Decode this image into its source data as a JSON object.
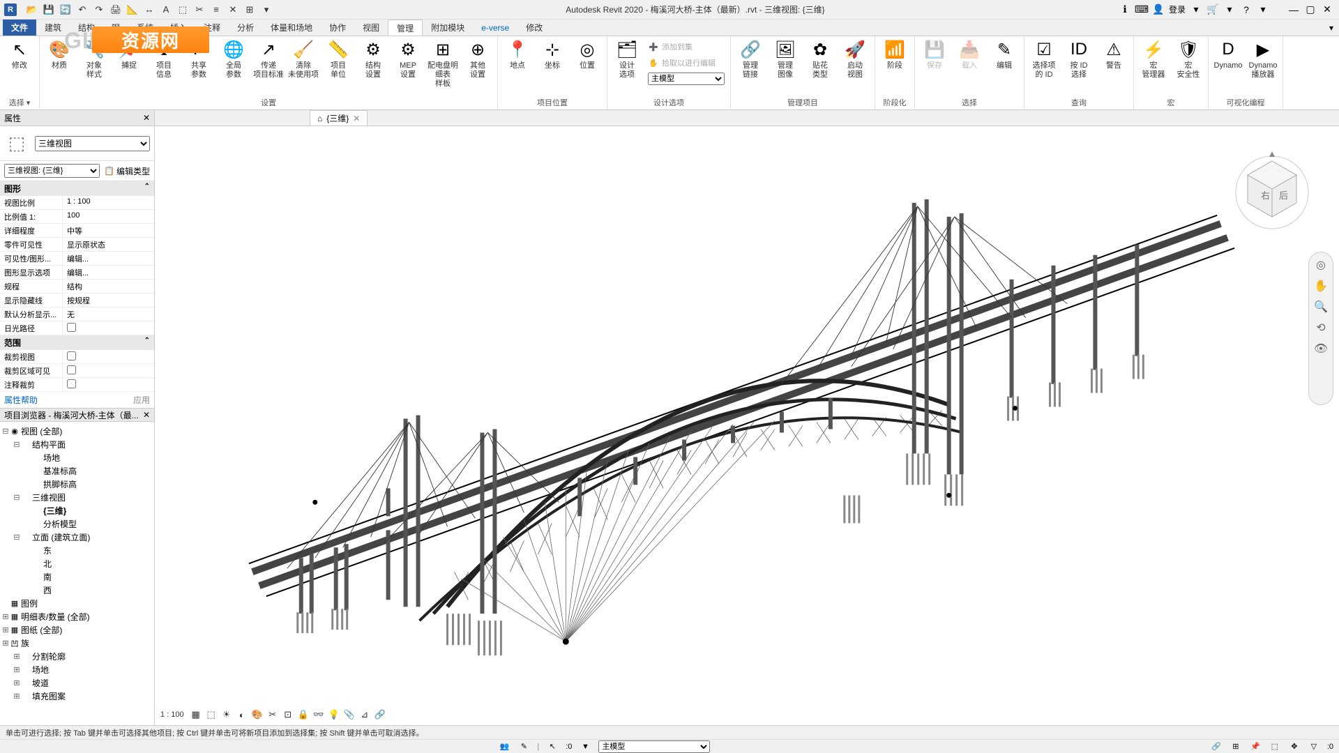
{
  "app": {
    "title": "Autodesk Revit 2020 - 梅溪河大桥-主体（最新）.rvt - 三维视图: {三维}",
    "logo": "R",
    "login": "登录",
    "qat_icons": [
      "folder",
      "save",
      "undo",
      "redo",
      "sep",
      "print",
      "measure",
      "sep",
      "line",
      "text",
      "sep",
      "3d",
      "sep",
      "section",
      "sep",
      "equals",
      "sep",
      "box",
      "minus"
    ]
  },
  "tabs": {
    "file": "文件",
    "items": [
      "建筑",
      "结构",
      "钢",
      "系统",
      "插入",
      "注释",
      "分析",
      "体量和场地",
      "协作",
      "视图",
      "管理",
      "附加模块",
      "e-verse",
      "修改"
    ],
    "active": "管理"
  },
  "ribbon": {
    "groups": [
      {
        "label": "选择 ▾",
        "buttons": [
          {
            "ico": "↖",
            "lbl": "修改"
          }
        ]
      },
      {
        "label": "设置",
        "buttons": [
          {
            "ico": "🎨",
            "lbl": "材质"
          },
          {
            "ico": "🔧",
            "lbl": "对象\n样式"
          },
          {
            "ico": "📌",
            "lbl": "捕捉"
          },
          {
            "ico": "ℹ",
            "lbl": "项目\n信息"
          },
          {
            "ico": "P",
            "lbl": "共享\n参数"
          },
          {
            "ico": "🌐",
            "lbl": "全局\n参数"
          },
          {
            "ico": "↗",
            "lbl": "传递\n项目标准"
          },
          {
            "ico": "🧹",
            "lbl": "清除\n未使用项"
          },
          {
            "ico": "📏",
            "lbl": "项目\n单位"
          },
          {
            "ico": "⚙",
            "lbl": "结构\n设置"
          },
          {
            "ico": "⚙",
            "lbl": "MEP\n设置"
          },
          {
            "ico": "⊞",
            "lbl": "配电盘明细表\n样板"
          },
          {
            "ico": "⊕",
            "lbl": "其他\n设置"
          }
        ]
      },
      {
        "label": "项目位置",
        "buttons": [
          {
            "ico": "📍",
            "lbl": "地点"
          },
          {
            "ico": "⊹",
            "lbl": "坐标"
          },
          {
            "ico": "◎",
            "lbl": "位置"
          }
        ]
      },
      {
        "label": "设计选项",
        "rows": [
          {
            "ico": "🗂",
            "lbl": "设计\n选项"
          },
          {
            "row": "添加到集",
            "ico2": "➕"
          },
          {
            "row": "拾取以进行编辑",
            "ico2": "✋"
          },
          {
            "sel": "主模型"
          }
        ]
      },
      {
        "label": "管理项目",
        "buttons": [
          {
            "ico": "🔗",
            "lbl": "管理\n链接"
          },
          {
            "ico": "🖼",
            "lbl": "管理\n图像"
          },
          {
            "ico": "✿",
            "lbl": "贴花\n类型"
          },
          {
            "ico": "🚀",
            "lbl": "启动\n视图"
          }
        ]
      },
      {
        "label": "阶段化",
        "buttons": [
          {
            "ico": "📶",
            "lbl": "阶段"
          }
        ]
      },
      {
        "label": "选择",
        "buttons": [
          {
            "ico": "💾",
            "lbl": "保存",
            "disabled": true
          },
          {
            "ico": "📥",
            "lbl": "载入",
            "disabled": true
          },
          {
            "ico": "✎",
            "lbl": "编辑"
          }
        ]
      },
      {
        "label": "查询",
        "buttons": [
          {
            "ico": "☑",
            "lbl": "选择项\n的 ID"
          },
          {
            "ico": "ID",
            "lbl": "按 ID\n选择"
          },
          {
            "ico": "⚠",
            "lbl": "警告"
          }
        ]
      },
      {
        "label": "宏",
        "buttons": [
          {
            "ico": "⚡",
            "lbl": "宏\n管理器"
          },
          {
            "ico": "🛡",
            "lbl": "宏\n安全性"
          }
        ]
      },
      {
        "label": "可视化编程",
        "buttons": [
          {
            "ico": "D",
            "lbl": "Dynamo"
          },
          {
            "ico": "▶",
            "lbl": "Dynamo\n播放器"
          }
        ]
      }
    ]
  },
  "watermark": "资源网",
  "doctab": {
    "icon": "⌂",
    "label": "{三维}"
  },
  "props": {
    "panel": "属性",
    "type": "三维视图",
    "instance": "三维视图: {三维}",
    "edit_type": "编辑类型",
    "cats": [
      {
        "name": "图形",
        "rows": [
          {
            "k": "视图比例",
            "v": "1 : 100"
          },
          {
            "k": "比例值 1:",
            "v": "100"
          },
          {
            "k": "详细程度",
            "v": "中等"
          },
          {
            "k": "零件可见性",
            "v": "显示原状态"
          },
          {
            "k": "可见性/图形...",
            "v": "编辑..."
          },
          {
            "k": "图形显示选项",
            "v": "编辑..."
          },
          {
            "k": "规程",
            "v": "结构"
          },
          {
            "k": "显示隐藏线",
            "v": "按规程"
          },
          {
            "k": "默认分析显示...",
            "v": "无"
          },
          {
            "k": "日光路径",
            "v": "",
            "cb": true
          }
        ]
      },
      {
        "name": "范围",
        "rows": [
          {
            "k": "裁剪视图",
            "v": "",
            "cb": true
          },
          {
            "k": "裁剪区域可见",
            "v": "",
            "cb": true
          },
          {
            "k": "注释裁剪",
            "v": "",
            "cb": true
          }
        ]
      }
    ],
    "help": "属性帮助",
    "apply": "应用"
  },
  "browser": {
    "title": "项目浏览器 - 梅溪河大桥-主体（最...",
    "tree": [
      {
        "d": 0,
        "tw": "⊟",
        "ic": "◉",
        "tx": "视图 (全部)"
      },
      {
        "d": 1,
        "tw": "⊟",
        "ic": "",
        "tx": "结构平面"
      },
      {
        "d": 2,
        "tw": "",
        "ic": "",
        "tx": "场地"
      },
      {
        "d": 2,
        "tw": "",
        "ic": "",
        "tx": "基准标高"
      },
      {
        "d": 2,
        "tw": "",
        "ic": "",
        "tx": "拱脚标高"
      },
      {
        "d": 1,
        "tw": "⊟",
        "ic": "",
        "tx": "三维视图"
      },
      {
        "d": 2,
        "tw": "",
        "ic": "",
        "tx": "{三维}",
        "bold": true
      },
      {
        "d": 2,
        "tw": "",
        "ic": "",
        "tx": "分析模型"
      },
      {
        "d": 1,
        "tw": "⊟",
        "ic": "",
        "tx": "立面 (建筑立面)"
      },
      {
        "d": 2,
        "tw": "",
        "ic": "",
        "tx": "东"
      },
      {
        "d": 2,
        "tw": "",
        "ic": "",
        "tx": "北"
      },
      {
        "d": 2,
        "tw": "",
        "ic": "",
        "tx": "南"
      },
      {
        "d": 2,
        "tw": "",
        "ic": "",
        "tx": "西"
      },
      {
        "d": 0,
        "tw": "",
        "ic": "▦",
        "tx": "图例"
      },
      {
        "d": 0,
        "tw": "⊞",
        "ic": "▦",
        "tx": "明细表/数量 (全部)"
      },
      {
        "d": 0,
        "tw": "⊞",
        "ic": "▦",
        "tx": "图纸 (全部)"
      },
      {
        "d": 0,
        "tw": "⊞",
        "ic": "凹",
        "tx": "族"
      },
      {
        "d": 1,
        "tw": "⊞",
        "ic": "",
        "tx": "分割轮廓"
      },
      {
        "d": 1,
        "tw": "⊞",
        "ic": "",
        "tx": "场地"
      },
      {
        "d": 1,
        "tw": "⊞",
        "ic": "",
        "tx": "坡道"
      },
      {
        "d": 1,
        "tw": "⊞",
        "ic": "",
        "tx": "填充图案"
      }
    ]
  },
  "vcb": {
    "scale": "1 : 100"
  },
  "status": {
    "msg": "单击可进行选择; 按 Tab 键并单击可选择其他项目; 按 Ctrl 键并单击可将新项目添加到选择集; 按 Shift 键并单击可取消选择。",
    "count": ":0",
    "filter": "主模型"
  },
  "viewcube": {
    "face": "右 后"
  }
}
